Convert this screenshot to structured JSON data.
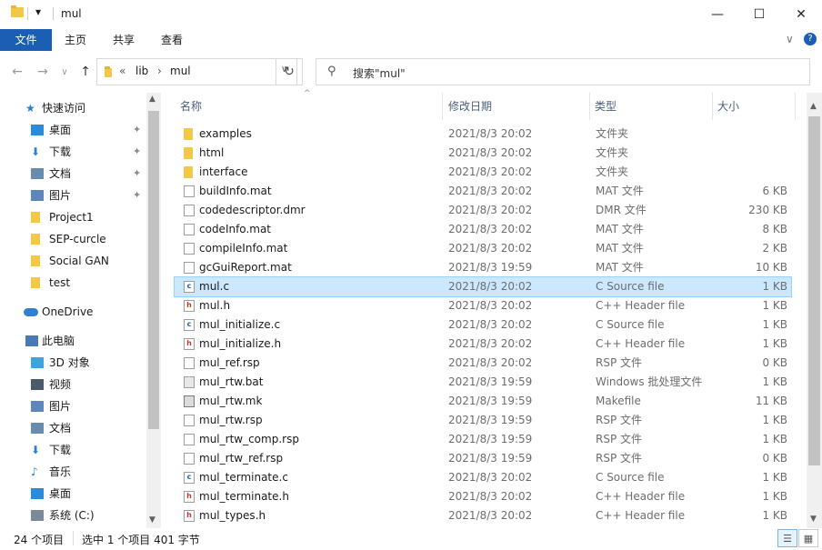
{
  "titlebar": {
    "title": "mul",
    "minimize_glyph": "—",
    "maximize_glyph": "☐",
    "close_glyph": "✕",
    "qat_dropdown_glyph": "▾"
  },
  "ribbon": {
    "tabs": [
      "文件",
      "主页",
      "共享",
      "查看"
    ],
    "expand_glyph": "∨",
    "help_glyph": "?"
  },
  "navbar": {
    "back_glyph": "←",
    "forward_glyph": "→",
    "recent_glyph": "∨",
    "up_glyph": "↑",
    "breadcrumb": [
      "«",
      "lib",
      "›",
      "mul"
    ],
    "refresh_glyph": "↻",
    "search_placeholder": "搜索\"mul\"",
    "search_glyph": "⚲"
  },
  "navpane": {
    "items": [
      {
        "label": "快速访问",
        "icon": "star-icon",
        "pinned": false
      },
      {
        "label": "桌面",
        "icon": "desktop-icon",
        "pinned": true
      },
      {
        "label": "下载",
        "icon": "download-icon",
        "pinned": true
      },
      {
        "label": "文档",
        "icon": "document-icon",
        "pinned": true
      },
      {
        "label": "图片",
        "icon": "picture-icon",
        "pinned": true
      },
      {
        "label": "Project1",
        "icon": "folder-icon",
        "pinned": false
      },
      {
        "label": "SEP-curcle",
        "icon": "folder-icon",
        "pinned": false
      },
      {
        "label": "Social GAN",
        "icon": "folder-icon",
        "pinned": false
      },
      {
        "label": "test",
        "icon": "folder-icon",
        "pinned": false
      },
      {
        "label": "OneDrive",
        "icon": "cloud-icon",
        "pinned": false
      },
      {
        "label": "此电脑",
        "icon": "computer-icon",
        "pinned": false
      },
      {
        "label": "3D 对象",
        "icon": "cube-icon",
        "pinned": false
      },
      {
        "label": "视频",
        "icon": "video-icon",
        "pinned": false
      },
      {
        "label": "图片",
        "icon": "picture-icon",
        "pinned": false
      },
      {
        "label": "文档",
        "icon": "document-icon",
        "pinned": false
      },
      {
        "label": "下载",
        "icon": "download-icon",
        "pinned": false
      },
      {
        "label": "音乐",
        "icon": "music-icon",
        "pinned": false
      },
      {
        "label": "桌面",
        "icon": "desktop-icon",
        "pinned": false
      },
      {
        "label": "系统 (C:)",
        "icon": "drive-icon",
        "pinned": false
      }
    ],
    "pin_glyph": "✦"
  },
  "columns": {
    "name": "名称",
    "date": "修改日期",
    "type": "类型",
    "size": "大小",
    "sort_glyph": "^"
  },
  "files": [
    {
      "name": "examples",
      "date": "2021/8/3 20:02",
      "type": "文件夹",
      "size": "",
      "icon": "folder"
    },
    {
      "name": "html",
      "date": "2021/8/3 20:02",
      "type": "文件夹",
      "size": "",
      "icon": "folder"
    },
    {
      "name": "interface",
      "date": "2021/8/3 20:02",
      "type": "文件夹",
      "size": "",
      "icon": "folder"
    },
    {
      "name": "buildInfo.mat",
      "date": "2021/8/3 20:02",
      "type": "MAT 文件",
      "size": "6 KB",
      "icon": "file"
    },
    {
      "name": "codedescriptor.dmr",
      "date": "2021/8/3 20:02",
      "type": "DMR 文件",
      "size": "230 KB",
      "icon": "file"
    },
    {
      "name": "codeInfo.mat",
      "date": "2021/8/3 20:02",
      "type": "MAT 文件",
      "size": "8 KB",
      "icon": "file"
    },
    {
      "name": "compileInfo.mat",
      "date": "2021/8/3 20:02",
      "type": "MAT 文件",
      "size": "2 KB",
      "icon": "file"
    },
    {
      "name": "gcGuiReport.mat",
      "date": "2021/8/3 19:59",
      "type": "MAT 文件",
      "size": "10 KB",
      "icon": "file"
    },
    {
      "name": "mul.c",
      "date": "2021/8/3 20:02",
      "type": "C Source file",
      "size": "1 KB",
      "icon": "c",
      "selected": true
    },
    {
      "name": "mul.h",
      "date": "2021/8/3 20:02",
      "type": "C++ Header file",
      "size": "1 KB",
      "icon": "h"
    },
    {
      "name": "mul_initialize.c",
      "date": "2021/8/3 20:02",
      "type": "C Source file",
      "size": "1 KB",
      "icon": "c"
    },
    {
      "name": "mul_initialize.h",
      "date": "2021/8/3 20:02",
      "type": "C++ Header file",
      "size": "1 KB",
      "icon": "h"
    },
    {
      "name": "mul_ref.rsp",
      "date": "2021/8/3 20:02",
      "type": "RSP 文件",
      "size": "0 KB",
      "icon": "file"
    },
    {
      "name": "mul_rtw.bat",
      "date": "2021/8/3 19:59",
      "type": "Windows 批处理文件",
      "size": "1 KB",
      "icon": "bat"
    },
    {
      "name": "mul_rtw.mk",
      "date": "2021/8/3 19:59",
      "type": "Makefile",
      "size": "11 KB",
      "icon": "mk"
    },
    {
      "name": "mul_rtw.rsp",
      "date": "2021/8/3 19:59",
      "type": "RSP 文件",
      "size": "1 KB",
      "icon": "file"
    },
    {
      "name": "mul_rtw_comp.rsp",
      "date": "2021/8/3 19:59",
      "type": "RSP 文件",
      "size": "1 KB",
      "icon": "file"
    },
    {
      "name": "mul_rtw_ref.rsp",
      "date": "2021/8/3 19:59",
      "type": "RSP 文件",
      "size": "0 KB",
      "icon": "file"
    },
    {
      "name": "mul_terminate.c",
      "date": "2021/8/3 20:02",
      "type": "C Source file",
      "size": "1 KB",
      "icon": "c"
    },
    {
      "name": "mul_terminate.h",
      "date": "2021/8/3 20:02",
      "type": "C++ Header file",
      "size": "1 KB",
      "icon": "h"
    },
    {
      "name": "mul_types.h",
      "date": "2021/8/3 20:02",
      "type": "C++ Header file",
      "size": "1 KB",
      "icon": "h"
    }
  ],
  "statusbar": {
    "item_count": "24 个项目",
    "selection": "选中 1 个项目  401 字节"
  },
  "colors": {
    "accent": "#1a5fb4",
    "selection_bg": "#cce8ff",
    "folder": "#f3c74a"
  }
}
